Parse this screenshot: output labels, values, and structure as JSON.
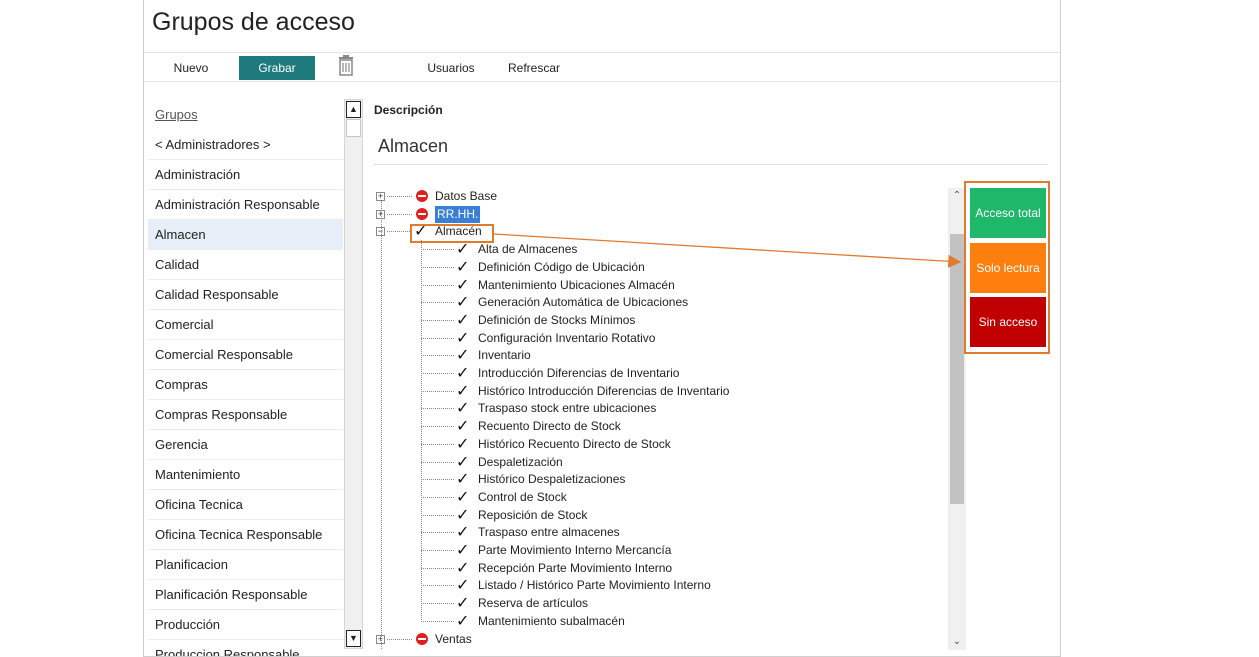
{
  "window": {
    "title": "Grupos de acceso"
  },
  "toolbar": {
    "nuevo": "Nuevo",
    "grabar": "Grabar",
    "usuarios": "Usuarios",
    "refrescar": "Refrescar"
  },
  "groups": {
    "header": "Grupos",
    "items": [
      "< Administradores >",
      "Administración",
      "Administración Responsable",
      "Almacen",
      "Calidad",
      "Calidad Responsable",
      "Comercial",
      "Comercial Responsable",
      "Compras",
      "Compras Responsable",
      "Gerencia",
      "Mantenimiento",
      "Oficina Tecnica",
      "Oficina Tecnica Responsable",
      "Planificacion",
      "Planificación Responsable",
      "Producción",
      "Produccion Responsable"
    ],
    "selected": "Almacen"
  },
  "description": {
    "label": "Descripción",
    "value": "Almacen"
  },
  "tree": {
    "nodes": [
      {
        "label": "Datos Base",
        "status": "none",
        "expanded": false
      },
      {
        "label": "RR.HH.",
        "status": "none",
        "expanded": false,
        "selected": true
      },
      {
        "label": "Almacén",
        "status": "full",
        "expanded": true
      },
      {
        "label": "Ventas",
        "status": "none",
        "expanded": false
      }
    ],
    "almacen_children": [
      "Alta de Almacenes",
      "Definición Código de Ubicación",
      "Mantenimiento Ubicaciones Almacén",
      "Generación Automática de Ubicaciones",
      "Definición de Stocks Mínimos",
      "Configuración Inventario Rotativo",
      "Inventario",
      "Introducción Diferencias de Inventario",
      "Histórico Introducción Diferencias de Inventario",
      "Traspaso stock entre ubicaciones",
      "Recuento Directo de Stock",
      "Histórico Recuento Directo de Stock",
      "Despaletización",
      "Histórico Despaletizaciones",
      "Control de Stock",
      "Reposición de Stock",
      "Traspaso entre almacenes",
      "Parte Movimiento Interno Mercancía",
      "Recepción Parte Movimiento Interno",
      "Listado / Histórico Parte Movimiento Interno",
      "Reserva de artículos",
      "Mantenimiento subalmacén"
    ]
  },
  "access_buttons": {
    "total": "Acceso total",
    "lectura": "Solo lectura",
    "sin": "Sin acceso"
  },
  "colors": {
    "grabar": "#1e7a7c",
    "acceso_total": "#1fb86a",
    "solo_lectura": "#ff7f0e",
    "sin_acceso": "#c00000",
    "callout": "#e07a2e",
    "selection": "#3a7fd6"
  },
  "icons": {
    "trash": "trash-icon",
    "none": "no-entry-icon",
    "full": "checkmark-icon"
  }
}
